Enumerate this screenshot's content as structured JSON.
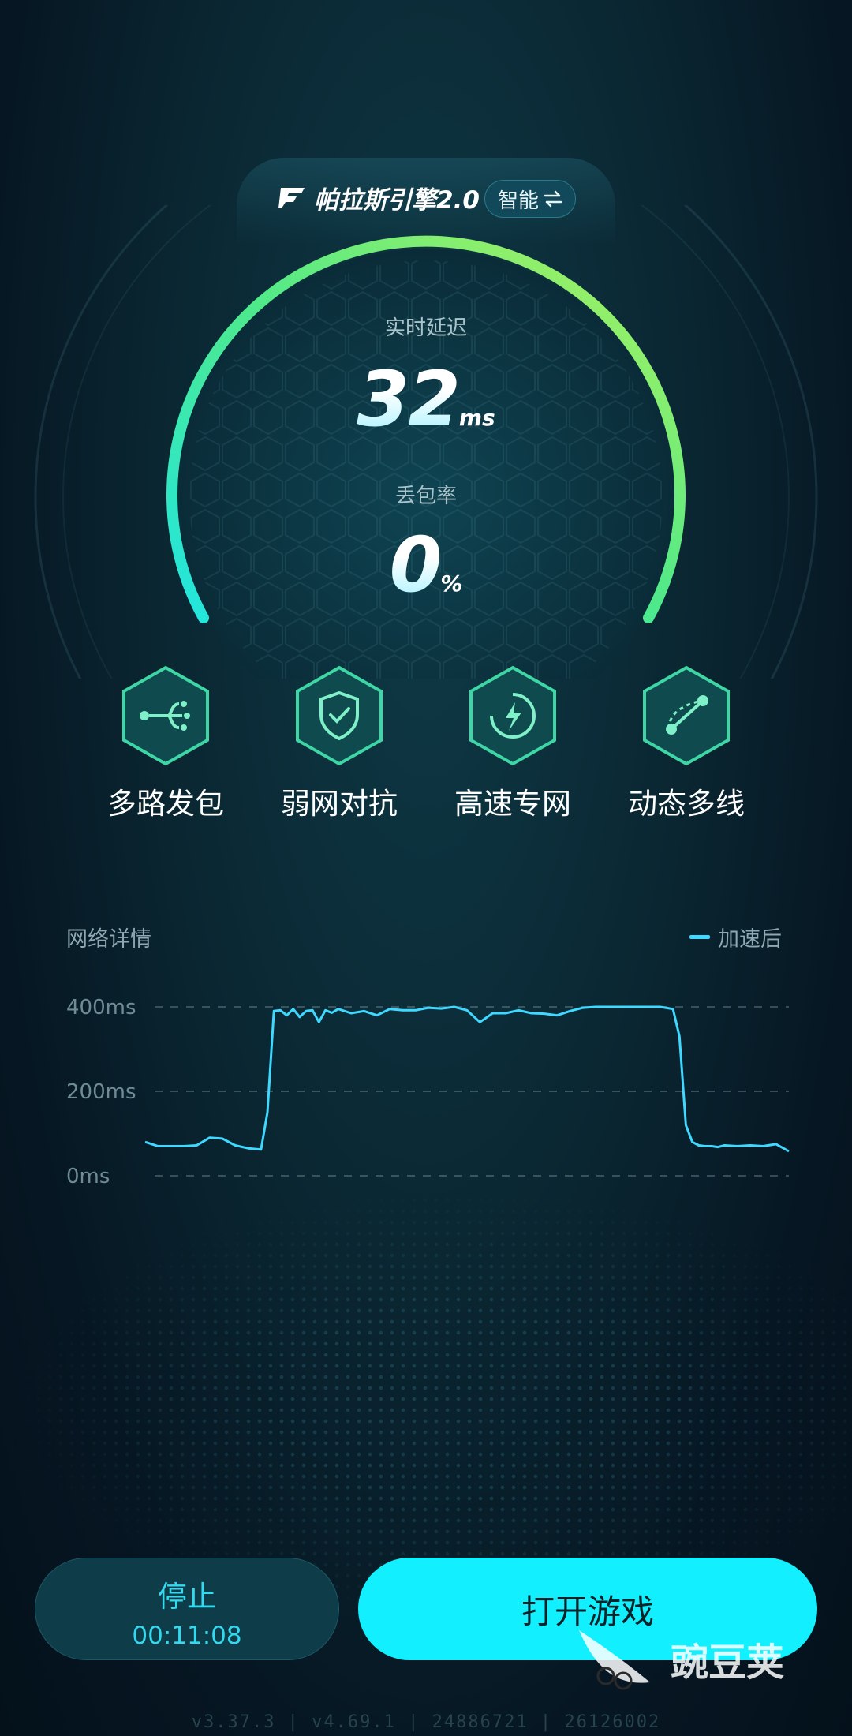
{
  "header": {
    "engine_title": "帕拉斯引擎2.0",
    "mode_label": "智能",
    "mode_icon": "swap-arrows-icon"
  },
  "gauge": {
    "latency_label": "实时延迟",
    "latency_value": "32",
    "latency_unit": "ms",
    "loss_label": "丢包率",
    "loss_value": "0",
    "loss_unit": "%",
    "arc_start_color": "#21e6e0",
    "arc_end_color": "#a6f25a"
  },
  "features": [
    {
      "label": "多路发包",
      "icon": "multipath-icon"
    },
    {
      "label": "弱网对抗",
      "icon": "shield-check-icon"
    },
    {
      "label": "高速专网",
      "icon": "lightning-icon"
    },
    {
      "label": "动态多线",
      "icon": "dynamic-route-icon"
    }
  ],
  "network": {
    "title": "网络详情",
    "legend": "加速后",
    "line_color": "#3fd8ff"
  },
  "chart_data": {
    "type": "line",
    "title": "网络详情",
    "y_ticks": [
      "400ms",
      "200ms",
      "0ms"
    ],
    "ylim": [
      0,
      400
    ],
    "grid": true,
    "legend_position": "top-right",
    "series": [
      {
        "name": "加速后",
        "x": [
          0,
          2,
          4,
          6,
          8,
          10,
          12,
          14,
          16,
          18,
          19,
          20,
          21,
          22,
          23,
          24,
          25,
          26,
          27,
          28,
          29,
          30,
          32,
          34,
          36,
          38,
          40,
          42,
          44,
          46,
          48,
          50,
          52,
          54,
          56,
          58,
          60,
          62,
          64,
          66,
          68,
          70,
          72,
          74,
          76,
          78,
          80,
          82,
          83,
          84,
          85,
          86,
          87,
          88,
          89,
          90,
          92,
          94,
          96,
          98,
          100
        ],
        "values": [
          80,
          70,
          70,
          70,
          72,
          90,
          88,
          72,
          65,
          62,
          150,
          390,
          392,
          380,
          395,
          376,
          390,
          392,
          364,
          392,
          386,
          395,
          385,
          390,
          380,
          395,
          392,
          392,
          398,
          396,
          400,
          392,
          364,
          385,
          385,
          392,
          385,
          384,
          380,
          390,
          398,
          400,
          400,
          400,
          400,
          400,
          400,
          395,
          330,
          120,
          80,
          72,
          70,
          70,
          68,
          72,
          70,
          72,
          70,
          75,
          58
        ]
      }
    ]
  },
  "controls": {
    "stop_label": "停止",
    "elapsed_time": "00:11:08",
    "open_game_label": "打开游戏"
  },
  "footer": {
    "version_text": "v3.37.3 | v4.69.1 |  24886721 |  26126002"
  },
  "watermark": {
    "text": "豌豆荚",
    "icon": "pea-pod-logo-icon"
  }
}
